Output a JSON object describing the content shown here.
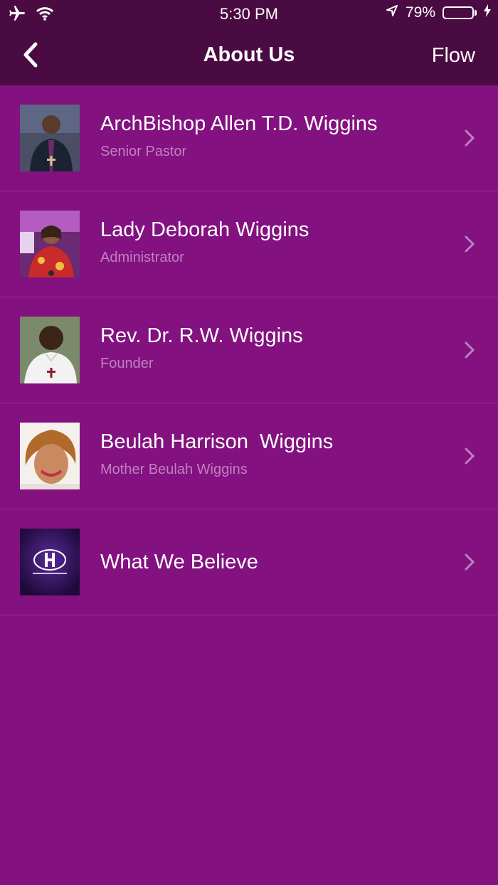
{
  "status_bar": {
    "time": "5:30 PM",
    "battery_percent": "79%",
    "battery_level": 0.79,
    "icons": [
      "airplane-icon",
      "wifi-icon",
      "location-arrow-icon",
      "battery-icon",
      "charging-bolt-icon"
    ]
  },
  "nav": {
    "title": "About Us",
    "right_label": "Flow",
    "back_icon": "chevron-left-icon"
  },
  "items": [
    {
      "name": "ArchBishop Allen T.D. Wiggins",
      "subtitle": "Senior Pastor"
    },
    {
      "name": "Lady Deborah Wiggins",
      "subtitle": "Administrator"
    },
    {
      "name": "Rev. Dr. R.W. Wiggins",
      "subtitle": "Founder"
    },
    {
      "name": "Beulah Harrison  Wiggins",
      "subtitle": "Mother Beulah Wiggins"
    },
    {
      "name": "What We Believe",
      "subtitle": ""
    }
  ],
  "colors": {
    "background": "#831180",
    "header": "#4a0b42",
    "subtitle": "#c081c0",
    "battery_fill": "#4cd964"
  }
}
